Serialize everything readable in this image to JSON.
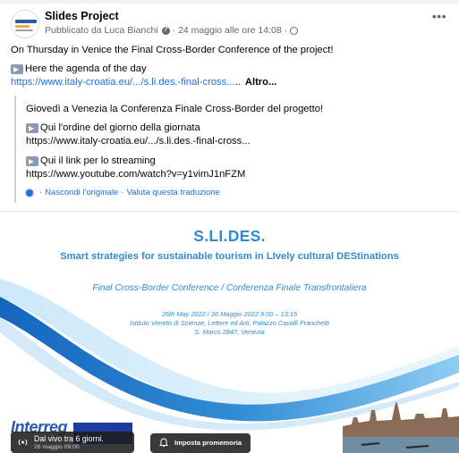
{
  "post": {
    "page_name": "Slides Project",
    "meta_published": "Pubblicato da Luca Bianchi",
    "meta_date": "· 24 maggio alle ore 14:08 ·",
    "more_icon": "more-horizontal-icon",
    "text_line1": "On Thursday in Venice the Final Cross-Border Conference of the project!",
    "text_line2": "Here the agenda of the day",
    "text_link": "https://www.italy-croatia.eu/.../s.li.des.-final-cross...",
    "text_ellipsis": "..",
    "more_label": "Altro..."
  },
  "translation": {
    "line1": "Giovedì a Venezia la Conferenza Finale Cross-Border del progetto!",
    "line2": "Qui l'ordine del giorno della giornata",
    "link1": "https://www.italy-croatia.eu/.../s.li.des.-final-cross...",
    "line3": "Qui il link per lo streaming",
    "link2": "https://www.youtube.com/watch?v=y1vimJ1nFZM",
    "hide_original": "Nascondi l'originale",
    "rate_translation": "Valuta questa traduzione"
  },
  "slide": {
    "title": "S.LI.DES.",
    "subtitle": "Smart strategies for sustainable tourism in LIvely cultural DEStinations",
    "conference": "Final Cross-Border Conference / Conferenza Finale Transfrontaliera",
    "date_line": "26th May 2022 / 26 Maggio 2022 9:00 – 13:15",
    "venue_line1": "Istituto Veneto di Scienze, Lettere ed Arti, Palazzo Cavalli Franchetti",
    "venue_line2": "S. Marco 2847, Venezia",
    "logo_text": "Interreg"
  },
  "live": {
    "label": "Dal vivo tra 6 giorni.",
    "date": "26 maggio 09:00",
    "reminder_label": "Imposta promemoria"
  },
  "colors": {
    "link": "#216fdb",
    "slide_accent": "#2f8bd2",
    "wave_dark": "#1f7fd0",
    "wave_light": "#a9d7f5"
  }
}
